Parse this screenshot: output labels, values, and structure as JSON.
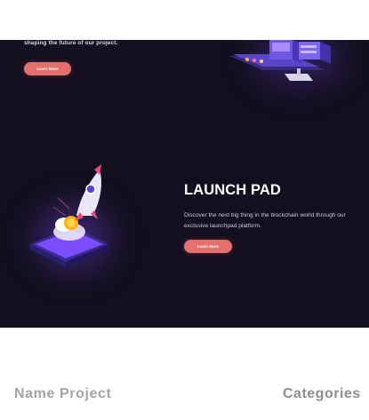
{
  "hero_top": {
    "tagline": "shaping the future of our project.",
    "button_label": "Learn More"
  },
  "launchpad": {
    "title": "LAUNCH PAD",
    "description": "Discover the next big thing in the blockchain world through our exclusive launchpad platform.",
    "button_label": "Learn More"
  },
  "table_header": {
    "name_project": "Name Project",
    "categories": "Categories"
  },
  "colors": {
    "hero_background": "#130f1e",
    "button": "#e56f6c",
    "purple_accent": "#7b4dff"
  },
  "icons": [
    "server-illustration-icon",
    "rocket-launch-illustration-icon"
  ]
}
